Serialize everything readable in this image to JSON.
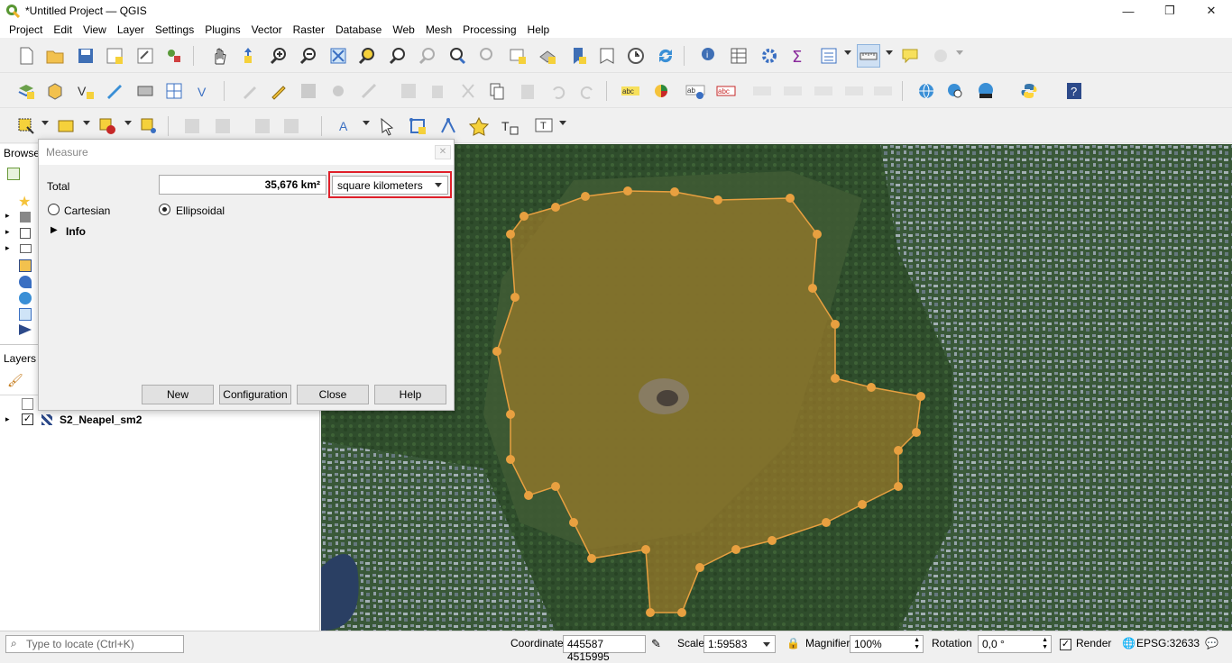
{
  "window": {
    "title": "*Untitled Project — QGIS"
  },
  "menu": [
    "Project",
    "Edit",
    "View",
    "Layer",
    "Settings",
    "Plugins",
    "Vector",
    "Raster",
    "Database",
    "Web",
    "Mesh",
    "Processing",
    "Help"
  ],
  "panels": {
    "browser_title": "Browse",
    "layers_title": "Layers"
  },
  "layers": [
    {
      "name": "S2_Neapel_sm2",
      "checked": true
    }
  ],
  "measure": {
    "title": "Measure",
    "total_label": "Total",
    "total_value": "35,676 km²",
    "unit": "square kilometers",
    "cartesian_label": "Cartesian",
    "ellipsoidal_label": "Ellipsoidal",
    "info_label": "Info",
    "buttons": {
      "new": "New",
      "configuration": "Configuration",
      "close": "Close",
      "help": "Help"
    }
  },
  "status": {
    "locate_placeholder": "Type to locate (Ctrl+K)",
    "coordinate_label": "Coordinate",
    "coordinate_value": "445587 4515995",
    "scale_label": "Scale",
    "scale_value": "1:59583",
    "magnifier_label": "Magnifier",
    "magnifier_value": "100%",
    "rotation_label": "Rotation",
    "rotation_value": "0,0 °",
    "render_label": "Render",
    "crs": "EPSG:32633"
  },
  "colors": {
    "highlight": "#e0202a",
    "polygon_fill": "#9a7a2a",
    "vertex": "#e8a040"
  }
}
